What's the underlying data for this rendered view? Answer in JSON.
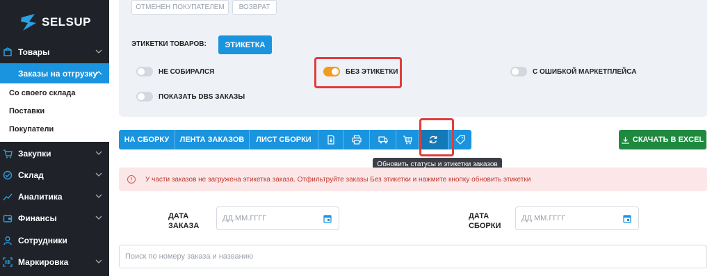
{
  "brand": {
    "name": "SELSUP"
  },
  "sidebar": {
    "items": [
      {
        "label": "Товары",
        "icon": "box-icon"
      },
      {
        "label": "Заказы на отгрузку",
        "icon": "orders-icon"
      },
      {
        "label": "Закупки",
        "icon": "cart-icon"
      },
      {
        "label": "Склад",
        "icon": "check-circle-icon"
      },
      {
        "label": "Аналитика",
        "icon": "chart-icon"
      },
      {
        "label": "Финансы",
        "icon": "wallet-icon"
      },
      {
        "label": "Сотрудники",
        "icon": "user-icon"
      },
      {
        "label": "Маркировка",
        "icon": "barcode-icon"
      }
    ],
    "subitems": [
      "Со своего склада",
      "Поставки",
      "Покупатели"
    ]
  },
  "filters": {
    "chips": [
      "ОТМЕНЕН ПОКУПАТЕЛЕМ",
      "ВОЗВРАТ"
    ],
    "labels_title": "ЭТИКЕТКИ ТОВАРОВ:",
    "label_button": "ЭТИКЕТКА",
    "toggles": {
      "not_collected": "НЕ СОБИРАЛСЯ",
      "no_label": "БЕЗ ЭТИКЕТКИ",
      "marketplace_error": "С ОШИБКОЙ МАРКЕТПЛЕЙСА",
      "show_dbs": "ПОКАЗАТЬ DBS ЗАКАЗЫ"
    }
  },
  "toolbar": {
    "to_assembly": "НА СБОРКУ",
    "orders_feed": "ЛЕНТА ЗАКАЗОВ",
    "assembly_sheet": "ЛИСТ СБОРКИ",
    "excel": "СКАЧАТЬ В EXCEL",
    "tooltip": "Обновить статусы и этикетки заказов"
  },
  "alert": {
    "text": "У части заказов не загружена этикетка заказа. Отфильтруйте заказы Без этикетки и нажмите кнопку обновить этикетки"
  },
  "dates": {
    "order_label_1": "ДАТА",
    "order_label_2": "ЗАКАЗА",
    "assembly_label_1": "ДАТА",
    "assembly_label_2": "СБОРКИ",
    "placeholder": "ДД.ММ.ГГГГ"
  },
  "search": {
    "placeholder": "Поиск по номеру заказа и названию"
  },
  "colors": {
    "accent": "#1a94df",
    "sidebar": "#1f2329",
    "excel": "#1f8a3f",
    "highlight": "#e03c3c",
    "toggle_on": "#f29b1f"
  }
}
